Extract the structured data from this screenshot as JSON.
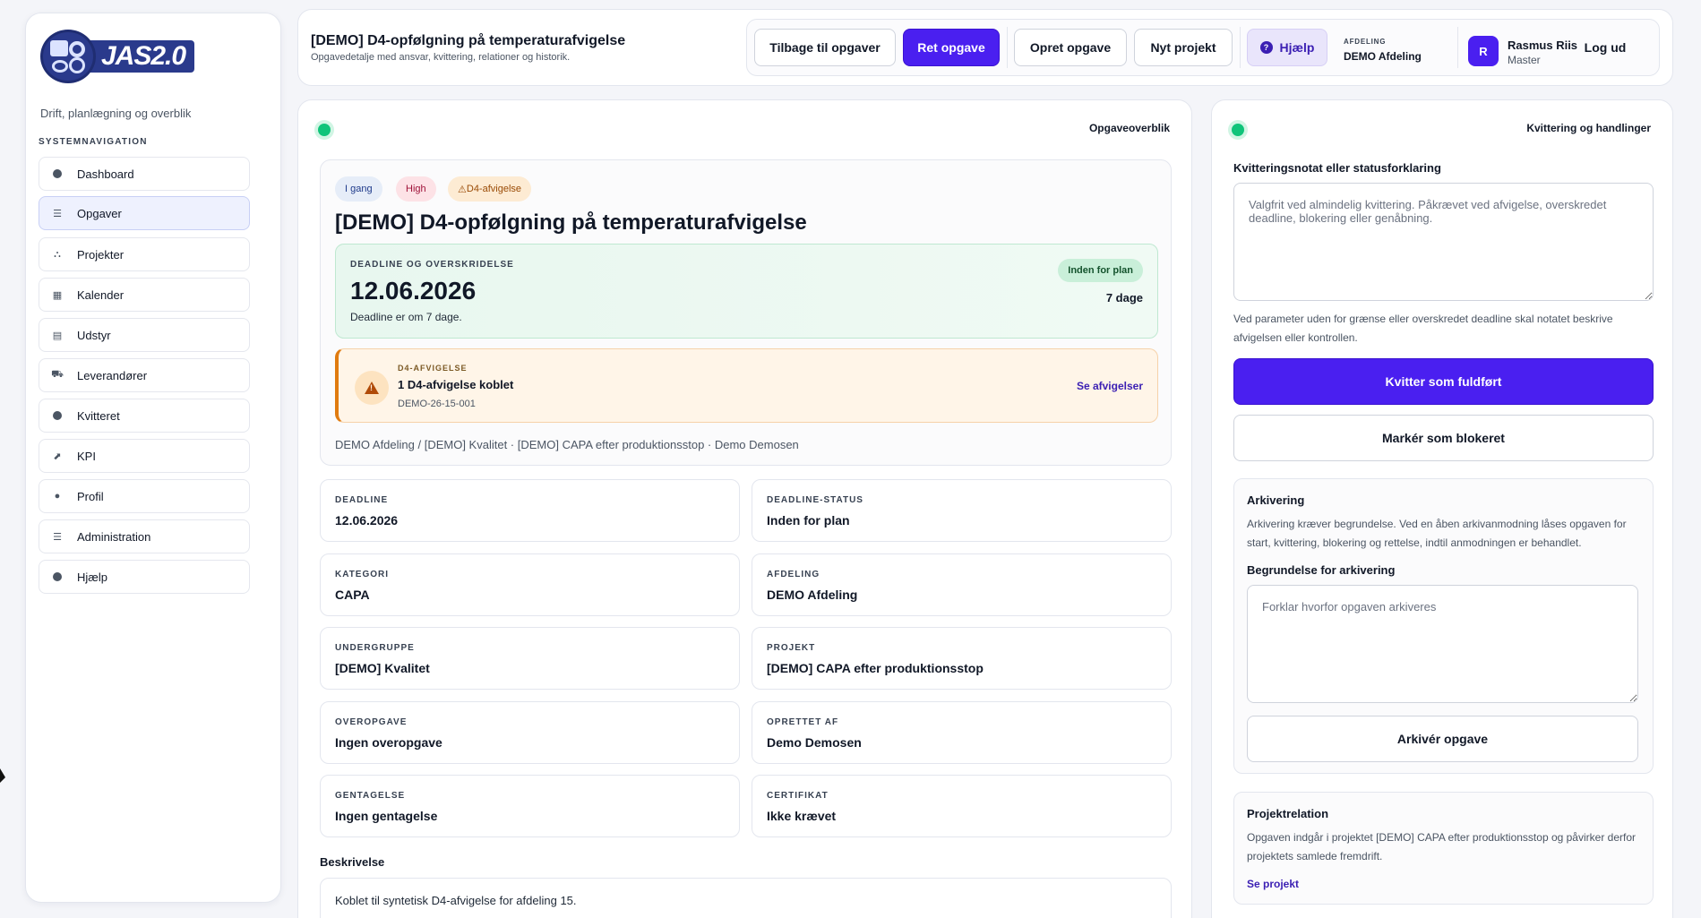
{
  "sidebar": {
    "logo_text": "JAS2.0",
    "tagline": "Drift, planlægning og overblik",
    "nav_heading": "SYSTEMNAVIGATION",
    "items": [
      {
        "label": "Dashboard",
        "icon": "dashboard-icon"
      },
      {
        "label": "Opgaver",
        "icon": "list-icon",
        "active": true
      },
      {
        "label": "Projekter",
        "icon": "project-icon"
      },
      {
        "label": "Kalender",
        "icon": "calendar-icon"
      },
      {
        "label": "Udstyr",
        "icon": "toolbox-icon"
      },
      {
        "label": "Leverandører",
        "icon": "truck-icon"
      },
      {
        "label": "Kvitteret",
        "icon": "check-circle-icon"
      },
      {
        "label": "KPI",
        "icon": "chart-icon"
      },
      {
        "label": "Profil",
        "icon": "user-icon"
      },
      {
        "label": "Administration",
        "icon": "sliders-icon"
      },
      {
        "label": "Hjælp",
        "icon": "help-icon"
      }
    ]
  },
  "header": {
    "title": "[DEMO] D4-opfølgning på temperaturafvigelse",
    "subtitle": "Opgavedetalje med ansvar, kvittering, relationer og historik.",
    "buttons": {
      "back": "Tilbage til opgaver",
      "edit": "Ret opgave",
      "create_task": "Opret opgave",
      "new_project": "Nyt projekt",
      "help": "Hjælp",
      "logout": "Log ud"
    },
    "department_label": "AFDELING",
    "department_value": "DEMO Afdeling",
    "user": {
      "initial": "R",
      "name": "Rasmus Riis",
      "role": "Master"
    }
  },
  "overview": {
    "panel_label": "Opgaveoverblik",
    "chips": {
      "status": "I gang",
      "priority": "High",
      "d4": "D4-afvigelse"
    },
    "title": "[DEMO] D4-opfølgning på temperaturafvigelse",
    "deadline": {
      "label": "DEADLINE OG OVERSKRIDELSE",
      "date": "12.06.2026",
      "note": "Deadline er om 7 dage.",
      "status_chip": "Inden for plan",
      "days": "7 dage"
    },
    "d4_box": {
      "label": "D4-AFVIGELSE",
      "title": "1 D4-afvigelse koblet",
      "code": "DEMO-26-15-001",
      "link": "Se afvigelser"
    },
    "breadcrumb": "DEMO Afdeling / [DEMO] Kvalitet · [DEMO] CAPA efter produktionsstop · Demo Demosen",
    "fields": [
      {
        "label": "DEADLINE",
        "value": "12.06.2026"
      },
      {
        "label": "DEADLINE-STATUS",
        "value": "Inden for plan"
      },
      {
        "label": "KATEGORI",
        "value": "CAPA"
      },
      {
        "label": "AFDELING",
        "value": "DEMO Afdeling"
      },
      {
        "label": "UNDERGRUPPE",
        "value": "[DEMO] Kvalitet"
      },
      {
        "label": "PROJEKT",
        "value": "[DEMO] CAPA efter produktionsstop"
      },
      {
        "label": "OVEROPGAVE",
        "value": "Ingen overopgave"
      },
      {
        "label": "OPRETTET AF",
        "value": "Demo Demosen"
      },
      {
        "label": "GENTAGELSE",
        "value": "Ingen gentagelse"
      },
      {
        "label": "CERTIFIKAT",
        "value": "Ikke krævet"
      }
    ],
    "description_heading": "Beskrivelse",
    "description": "Koblet til syntetisk D4-afvigelse for afdeling 15."
  },
  "actions": {
    "panel_label": "Kvittering og handlinger",
    "note_label": "Kvitteringsnotat eller statusforklaring",
    "note_placeholder": "Valgfrit ved almindelig kvittering. Påkrævet ved afvigelse, overskredet deadline, blokering eller genåbning.",
    "note_hint": "Ved parameter uden for grænse eller overskredet deadline skal notatet beskrive afvigelsen eller kontrollen.",
    "complete_button": "Kvitter som fuldført",
    "block_button": "Markér som blokeret",
    "archive": {
      "title": "Arkivering",
      "text": "Arkivering kræver begrundelse. Ved en åben arkivanmodning låses opgaven for start, kvittering, blokering og rettelse, indtil anmodningen er behandlet.",
      "reason_label": "Begrundelse for arkivering",
      "reason_placeholder": "Forklar hvorfor opgaven arkiveres",
      "button": "Arkivér opgave"
    },
    "project_relation": {
      "title": "Projektrelation",
      "text": "Opgaven indgår i projektet [DEMO] CAPA efter produktionsstop og påvirker derfor projektets samlede fremdrift.",
      "link": "Se projekt"
    }
  },
  "colors": {
    "accent": "#4a1ff0",
    "success": "#10c47a",
    "warning": "#e07b10"
  }
}
